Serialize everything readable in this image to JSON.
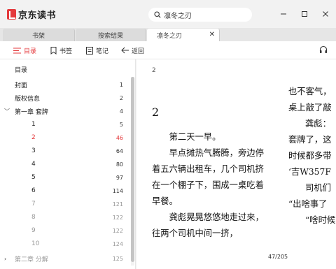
{
  "app": {
    "name": "京东读书"
  },
  "search": {
    "value": "凛冬之刃"
  },
  "tabs": [
    {
      "label": "书架"
    },
    {
      "label": "搜索结果"
    },
    {
      "label": "凛冬之刃"
    }
  ],
  "toolbar": {
    "toc_label": "目录",
    "bookmark_label": "书签",
    "notes_label": "笔记",
    "back_label": "返回"
  },
  "toc": {
    "title": "目录",
    "items": [
      {
        "label": "封面",
        "page": "1"
      },
      {
        "label": "版权信息",
        "page": "2"
      },
      {
        "label": "第一章 套牌",
        "page": "4"
      },
      {
        "label": "1",
        "page": "5"
      },
      {
        "label": "2",
        "page": "46"
      },
      {
        "label": "3",
        "page": "64"
      },
      {
        "label": "4",
        "page": "80"
      },
      {
        "label": "5",
        "page": "97"
      },
      {
        "label": "6",
        "page": "114"
      },
      {
        "label": "7",
        "page": "121"
      },
      {
        "label": "8",
        "page": "122"
      },
      {
        "label": "9",
        "page": "122"
      },
      {
        "label": "10",
        "page": "124"
      },
      {
        "label": "第二章 分解",
        "page": "125"
      }
    ]
  },
  "reader": {
    "page_label_top": "2",
    "chapter_heading": "2",
    "paragraphs": [
      "第二天一早。",
      "早点摊热气腾腾，旁边停着五六辆出租车，几个司机挤在一个棚子下，围成一桌吃着早餐。",
      "龚彪晃晃悠悠地走过来，往两个司机中间一挤，"
    ],
    "col2_lines": [
      "也不客气，",
      "桌上敲了敲",
      "龚彪：",
      "套牌了，这",
      "时候都多带",
      "‘吉W357F",
      "司机们",
      "“出啥事了",
      "“啥时候"
    ],
    "page_indicator": "47/205"
  },
  "colors": {
    "accent": "#e4393c"
  }
}
